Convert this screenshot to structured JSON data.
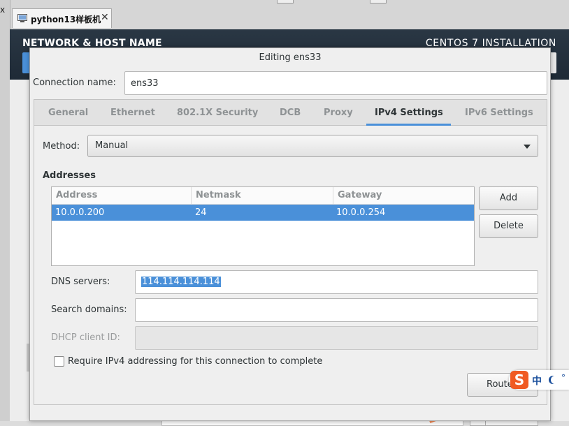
{
  "host": {
    "close_glyph": "x",
    "vm_tab_label": "python13样板机",
    "vm_tab_close": "✕"
  },
  "installer": {
    "title": "NETWORK & HOST NAME",
    "product": "CENTOS 7 INSTALLATION"
  },
  "dialog": {
    "title": "Editing ens33",
    "connection_name_label": "Connection name:",
    "connection_name_value": "ens33",
    "tabs": [
      {
        "label": "General"
      },
      {
        "label": "Ethernet"
      },
      {
        "label": "802.1X Security"
      },
      {
        "label": "DCB"
      },
      {
        "label": "Proxy"
      },
      {
        "label": "IPv4 Settings"
      },
      {
        "label": "IPv6 Settings"
      }
    ],
    "active_tab": "IPv4 Settings",
    "ipv4": {
      "method_label": "Method:",
      "method_value": "Manual",
      "addresses_heading": "Addresses",
      "columns": [
        "Address",
        "Netmask",
        "Gateway"
      ],
      "rows": [
        {
          "address": "10.0.0.200",
          "netmask": "24",
          "gateway": "10.0.0.254"
        }
      ],
      "add_button": "Add",
      "delete_button": "Delete",
      "dns_label": "DNS servers:",
      "dns_value": "114.114.114.114",
      "search_label": "Search domains:",
      "search_value": "",
      "dhcp_label": "DHCP client ID:",
      "dhcp_value": "",
      "require_label": "Require IPv4 addressing for this connection to complete",
      "require_checked": false,
      "routes_button": "Route"
    }
  },
  "ime": {
    "logo": "S",
    "mode": "中",
    "dots": "°"
  },
  "colors": {
    "accent": "#4a90d9",
    "header_bg": "#243140",
    "ime_orange": "#f05a22"
  }
}
